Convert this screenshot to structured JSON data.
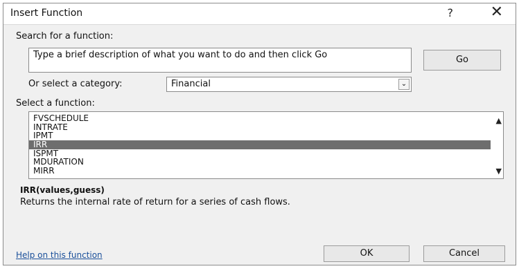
{
  "dialog": {
    "title": "Insert Function",
    "help_button": "?",
    "close_button": "✕"
  },
  "search": {
    "label": "Search for a function:",
    "value": "Type a brief description of what you want to do and then click Go",
    "go_label": "Go"
  },
  "category": {
    "label": "Or select a category:",
    "selected": "Financial"
  },
  "functions": {
    "label": "Select a function:",
    "items": [
      "FVSCHEDULE",
      "INTRATE",
      "IPMT",
      "IRR",
      "ISPMT",
      "MDURATION",
      "MIRR"
    ],
    "selected_index": 3
  },
  "details": {
    "syntax": "IRR(values,guess)",
    "description": "Returns the internal rate of return for a series of cash flows."
  },
  "footer": {
    "help_link": "Help on this function",
    "ok_label": "OK",
    "cancel_label": "Cancel"
  },
  "icons": {
    "dropdown": "chevron-down-icon",
    "scroll_up": "chevron-up-icon",
    "scroll_down": "chevron-down-icon"
  }
}
